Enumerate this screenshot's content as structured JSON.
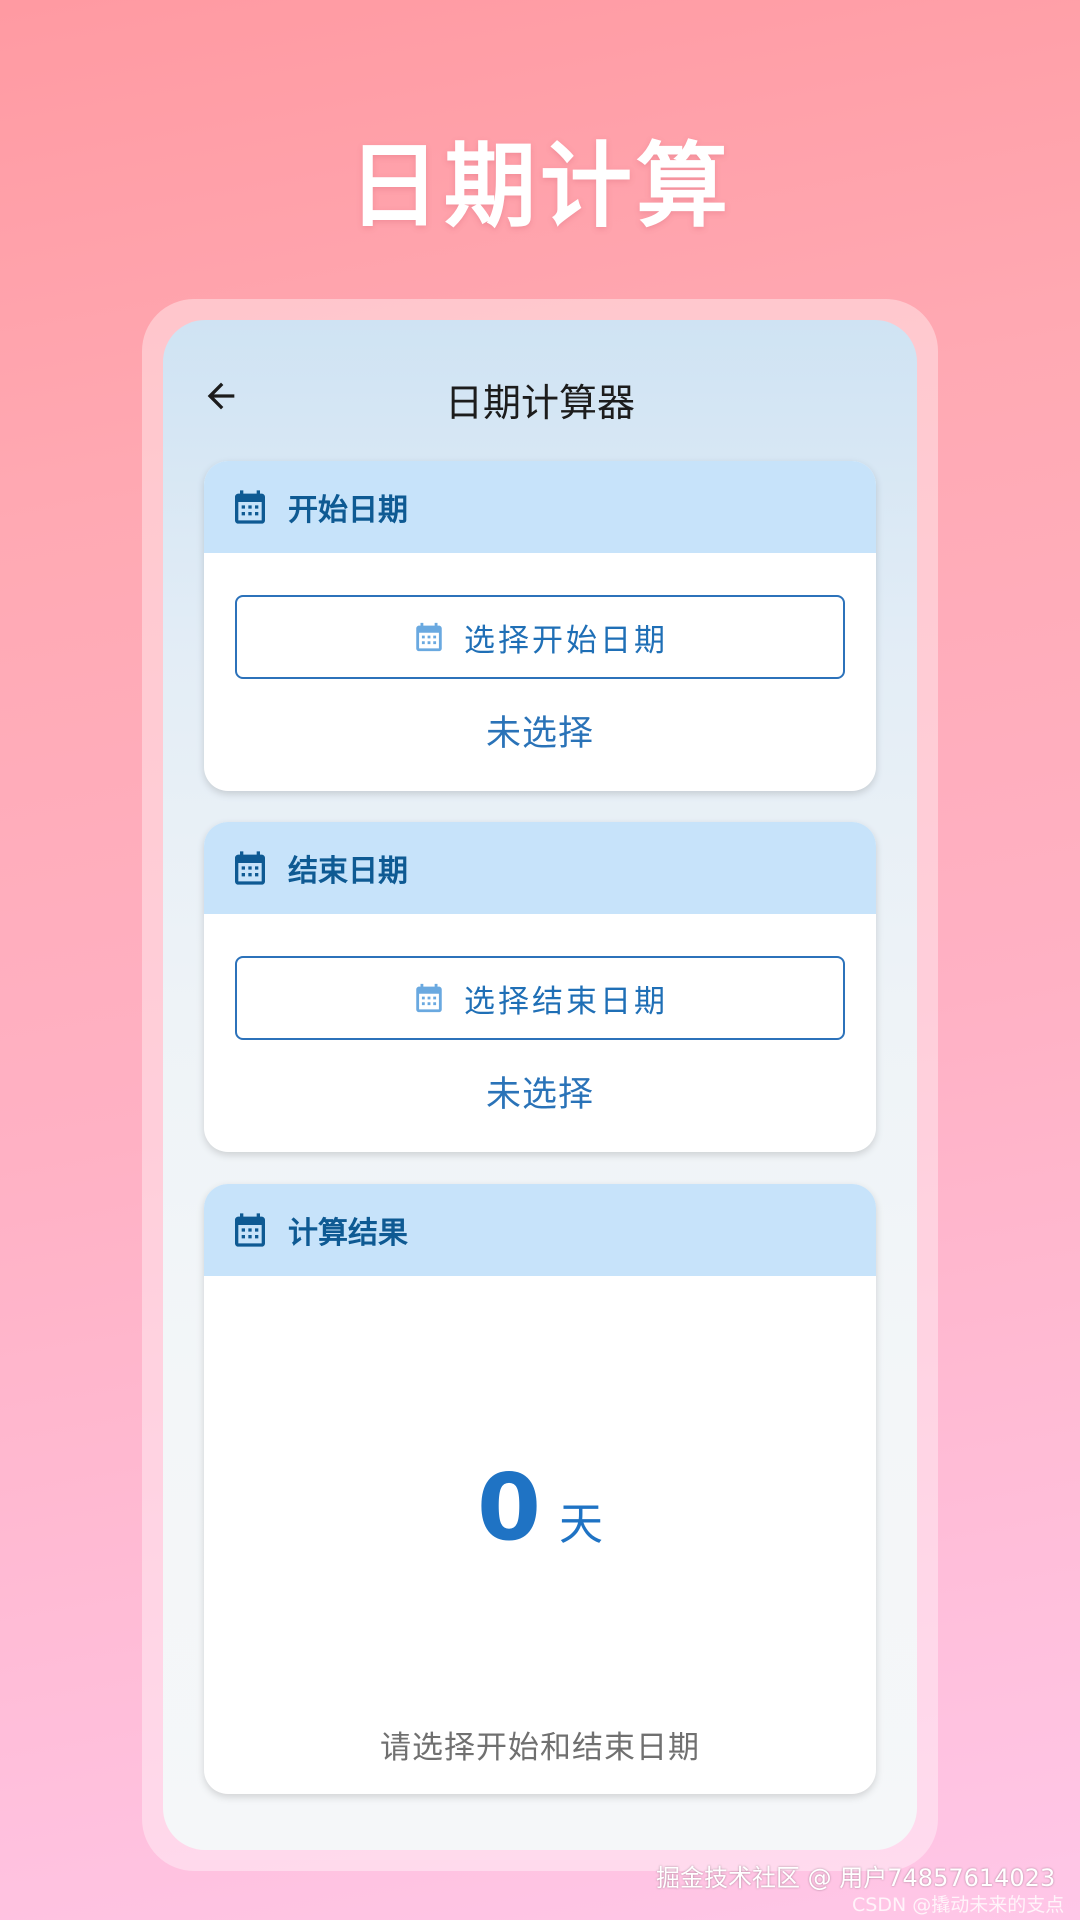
{
  "promo_title": "日期计算",
  "app": {
    "title": "日期计算器",
    "back_icon": "arrow-left-icon"
  },
  "start_card": {
    "title": "开始日期",
    "icon": "calendar-icon",
    "button_label": "选择开始日期",
    "status": "未选择"
  },
  "end_card": {
    "title": "结束日期",
    "icon": "calendar-icon",
    "button_label": "选择结束日期",
    "status": "未选择"
  },
  "result_card": {
    "title": "计算结果",
    "icon": "calendar-icon",
    "value": "0",
    "unit": "天",
    "hint": "请选择开始和结束日期"
  },
  "watermark": {
    "main": "掘金技术社区 @ 用户74857614023",
    "sub": "CSDN @撬动未来的支点"
  },
  "colors": {
    "accent": "#1f73c4",
    "header_bg": "#c7e3fa",
    "header_text": "#0e5a93",
    "hint_text": "#707070"
  }
}
